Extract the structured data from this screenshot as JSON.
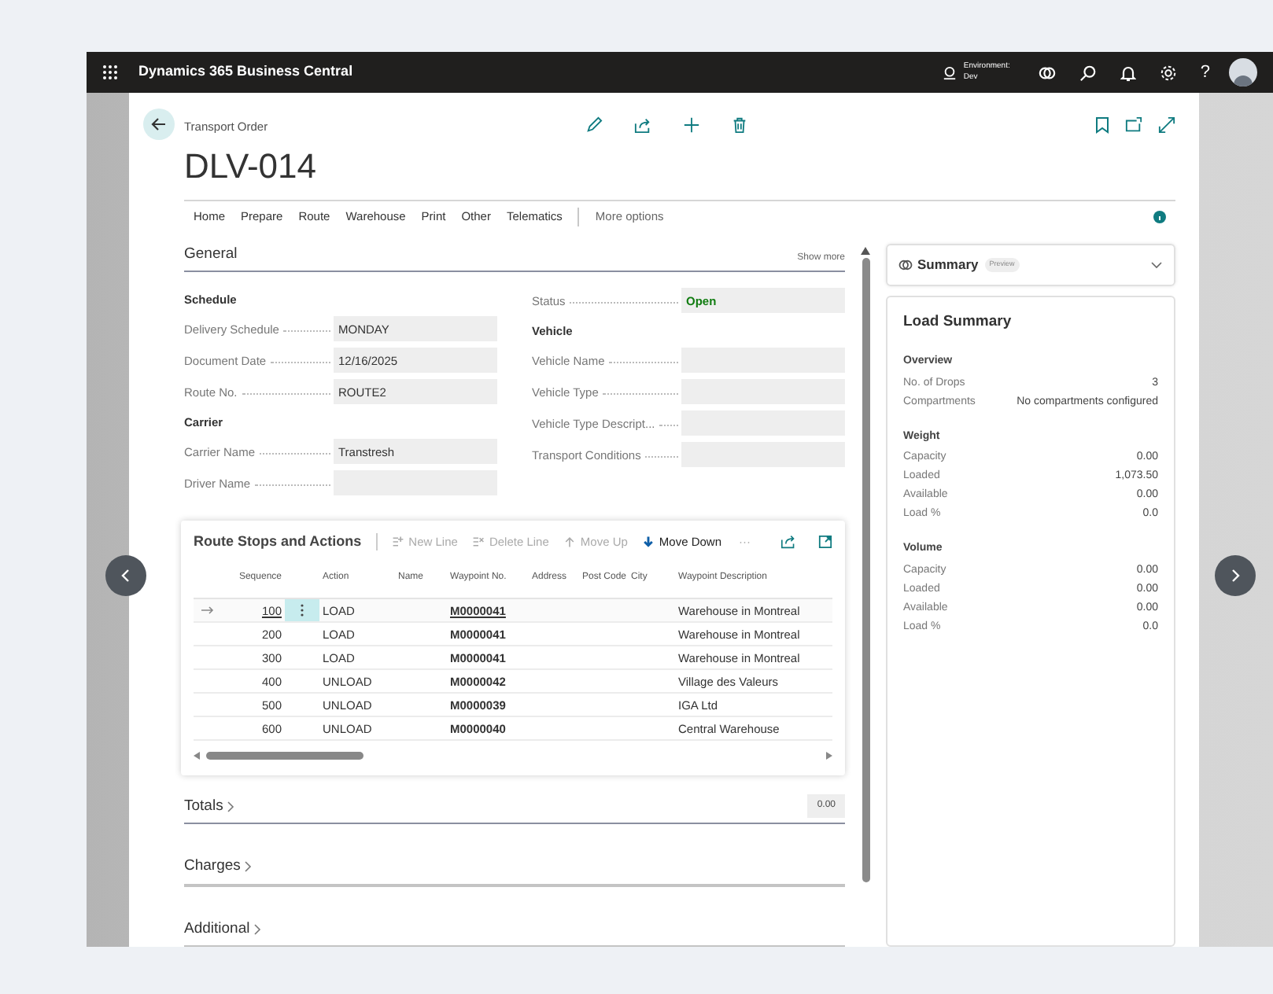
{
  "app_bar": {
    "title": "Dynamics 365 Business Central",
    "environment_label": "Environment:",
    "environment_name": "Dev",
    "help": "?"
  },
  "page": {
    "caption": "Transport Order",
    "title": "DLV-014"
  },
  "action_menu": [
    {
      "label": "Home"
    },
    {
      "label": "Prepare"
    },
    {
      "label": "Route"
    },
    {
      "label": "Warehouse"
    },
    {
      "label": "Print"
    },
    {
      "label": "Other"
    },
    {
      "label": "Telematics"
    }
  ],
  "more_options": "More options",
  "general": {
    "title": "General",
    "show_more": "Show more",
    "left": [
      {
        "kind": "heading",
        "label": "Schedule"
      },
      {
        "kind": "field",
        "label": "Delivery Schedule",
        "value": "MONDAY"
      },
      {
        "kind": "field",
        "label": "Document Date",
        "value": "12/16/2025"
      },
      {
        "kind": "field",
        "label": "Route No.",
        "value": "ROUTE2"
      },
      {
        "kind": "heading",
        "label": "Carrier"
      },
      {
        "kind": "field",
        "label": "Carrier Name",
        "value": "Transtresh"
      },
      {
        "kind": "field",
        "label": "Driver Name"
      }
    ],
    "right": [
      {
        "kind": "field",
        "label": "Status",
        "value": "Open",
        "color": "#107c10"
      },
      {
        "kind": "heading",
        "label": "Vehicle"
      },
      {
        "kind": "field",
        "label": "Vehicle Name"
      },
      {
        "kind": "field",
        "label": "Vehicle Type"
      },
      {
        "kind": "field",
        "label": "Vehicle Type Descript..."
      },
      {
        "kind": "field",
        "label": "Transport Conditions"
      }
    ]
  },
  "route_stops": {
    "title": "Route Stops and Actions",
    "more": "···",
    "actions": [
      {
        "kind": "new",
        "label": "New Line",
        "disabled": true
      },
      {
        "kind": "delete",
        "label": "Delete Line",
        "disabled": true
      },
      {
        "kind": "up",
        "label": "Move Up",
        "disabled": true
      },
      {
        "kind": "down",
        "label": "Move Down",
        "disabled": false
      }
    ],
    "columns": [
      "Sequence",
      "Action",
      "Name",
      "Waypoint No.",
      "Address",
      "Post Code",
      "City",
      "Waypoint Description"
    ],
    "rows": [
      {
        "selected": true,
        "sequence": "100",
        "action": "LOAD",
        "waypoint_no": "M0000041",
        "waypoint_description": "Warehouse in Montreal"
      },
      {
        "selected": false,
        "sequence": "200",
        "action": "LOAD",
        "waypoint_no": "M0000041",
        "waypoint_description": "Warehouse in Montreal"
      },
      {
        "selected": false,
        "sequence": "300",
        "action": "LOAD",
        "waypoint_no": "M0000041",
        "waypoint_description": "Warehouse in Montreal"
      },
      {
        "selected": false,
        "sequence": "400",
        "action": "UNLOAD",
        "waypoint_no": "M0000042",
        "waypoint_description": "Village des Valeurs"
      },
      {
        "selected": false,
        "sequence": "500",
        "action": "UNLOAD",
        "waypoint_no": "M0000039",
        "waypoint_description": "IGA Ltd"
      },
      {
        "selected": false,
        "sequence": "600",
        "action": "UNLOAD",
        "waypoint_no": "M0000040",
        "waypoint_description": "Central Warehouse"
      }
    ]
  },
  "sections": [
    {
      "title": "Totals",
      "value": "0.00"
    },
    {
      "title": "Charges"
    },
    {
      "title": "Additional"
    }
  ],
  "summary": {
    "title": "Summary",
    "badge": "Preview",
    "card_title": "Load Summary",
    "groups": [
      {
        "title": "Overview",
        "rows": [
          {
            "label": "No. of Drops",
            "value": "3"
          },
          {
            "label": "Compartments",
            "value": "No compartments configured"
          }
        ]
      },
      {
        "title": "Weight",
        "rows": [
          {
            "label": "Capacity",
            "value": "0.00"
          },
          {
            "label": "Loaded",
            "value": "1,073.50"
          },
          {
            "label": "Available",
            "value": "0.00"
          },
          {
            "label": "Load %",
            "value": "0.0"
          }
        ]
      },
      {
        "title": "Volume",
        "rows": [
          {
            "label": "Capacity",
            "value": "0.00"
          },
          {
            "label": "Loaded",
            "value": "0.00"
          },
          {
            "label": "Available",
            "value": "0.00"
          },
          {
            "label": "Load %",
            "value": "0.0"
          }
        ]
      }
    ]
  }
}
